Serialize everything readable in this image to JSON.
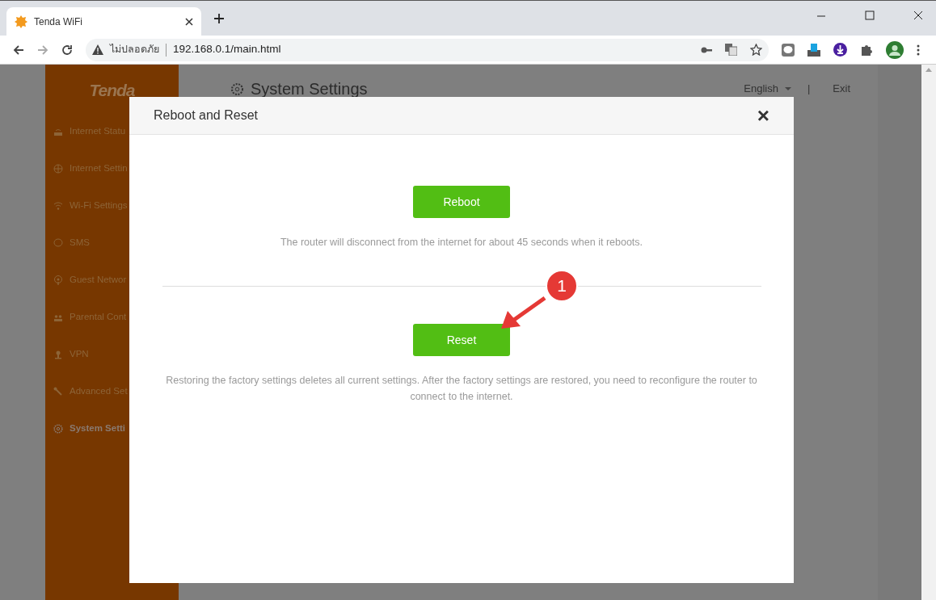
{
  "browser": {
    "tab_title": "Tenda WiFi",
    "security_label": "ไม่ปลอดภัย",
    "url": "192.168.0.1/main.html"
  },
  "sidebar": {
    "logo": "Tenda",
    "items": [
      {
        "label": "Internet Statu",
        "kind": "router",
        "selected": false
      },
      {
        "label": "Internet Settin",
        "kind": "globe",
        "selected": false
      },
      {
        "label": "Wi-Fi Settings",
        "kind": "wifi",
        "selected": false
      },
      {
        "label": "SMS",
        "kind": "sms",
        "selected": false
      },
      {
        "label": "Guest Networ",
        "kind": "guest",
        "selected": false
      },
      {
        "label": "Parental Cont",
        "kind": "people",
        "selected": false
      },
      {
        "label": "VPN",
        "kind": "vpn",
        "selected": false
      },
      {
        "label": "Advanced Set",
        "kind": "wrench",
        "selected": false
      },
      {
        "label": "System Setti",
        "kind": "gear",
        "selected": true
      }
    ]
  },
  "header": {
    "title": "System Settings",
    "language": "English",
    "separator": "|",
    "exit": "Exit"
  },
  "dialog": {
    "title": "Reboot and Reset",
    "close": "×",
    "sections": [
      {
        "button": "Reboot",
        "description": "The router will disconnect from the internet for about 45 seconds when it reboots."
      },
      {
        "button": "Reset",
        "description": "Restoring the factory settings deletes all current settings. After the factory settings are restored, you need to reconfigure the router to connect to the internet."
      }
    ]
  },
  "annotation": {
    "label": "1"
  }
}
